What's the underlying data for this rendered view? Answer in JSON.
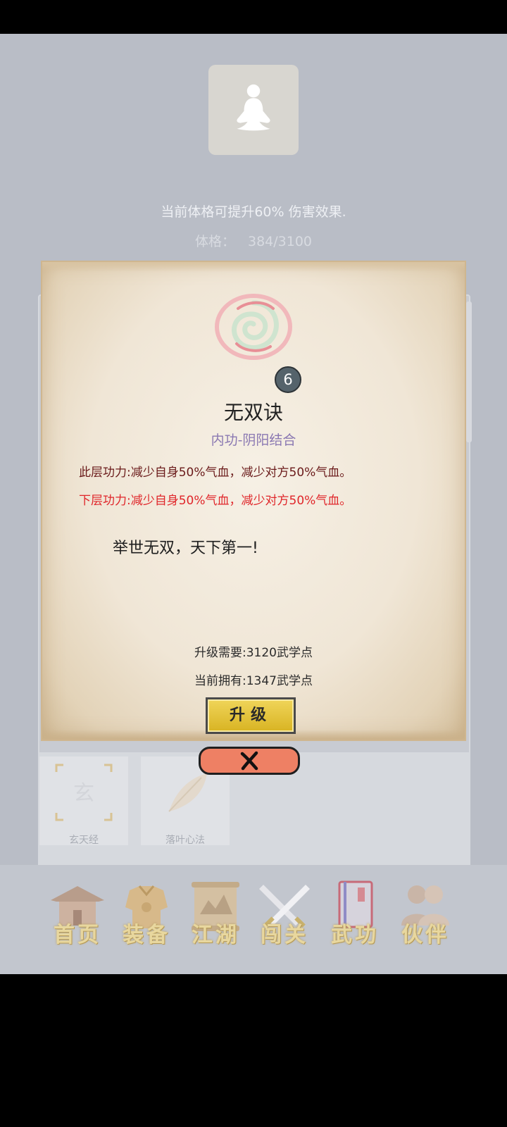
{
  "header": {
    "bonus_text": "当前体格可提升60% 伤害效果.",
    "stat_label": "体格：",
    "stat_value": "384/3100"
  },
  "skill_list": [
    {
      "name": "玄天经",
      "icon": "xuan-scroll-icon"
    },
    {
      "name": "落叶心法",
      "icon": "leaf-icon"
    }
  ],
  "dialog": {
    "level": "6",
    "name": "无双诀",
    "type": "内功-阴阳结合",
    "current_effect": "此层功力:减少自身50%气血，减少对方50%气血。",
    "next_effect": "下层功力:减少自身50%气血，减少对方50%气血。",
    "quote": "举世无双，天下第一!",
    "upgrade_need": "升级需要:3120武学点",
    "current_have": "当前拥有:1347武学点",
    "upgrade_label": "升级",
    "close_icon": "close-x-icon"
  },
  "tabs": [
    {
      "label": "首页",
      "icon": "house-icon"
    },
    {
      "label": "装备",
      "icon": "armor-icon"
    },
    {
      "label": "江湖",
      "icon": "map-scroll-icon"
    },
    {
      "label": "闯关",
      "icon": "crossed-swords-icon"
    },
    {
      "label": "武功",
      "icon": "book-icon"
    },
    {
      "label": "伙伴",
      "icon": "companions-icon"
    }
  ],
  "colors": {
    "effect_current": "#6a1a1a",
    "effect_next": "#e0262a",
    "skill_type": "#8a78b2",
    "upgrade_button": "#e6c63a",
    "close_button": "#ee8064"
  }
}
